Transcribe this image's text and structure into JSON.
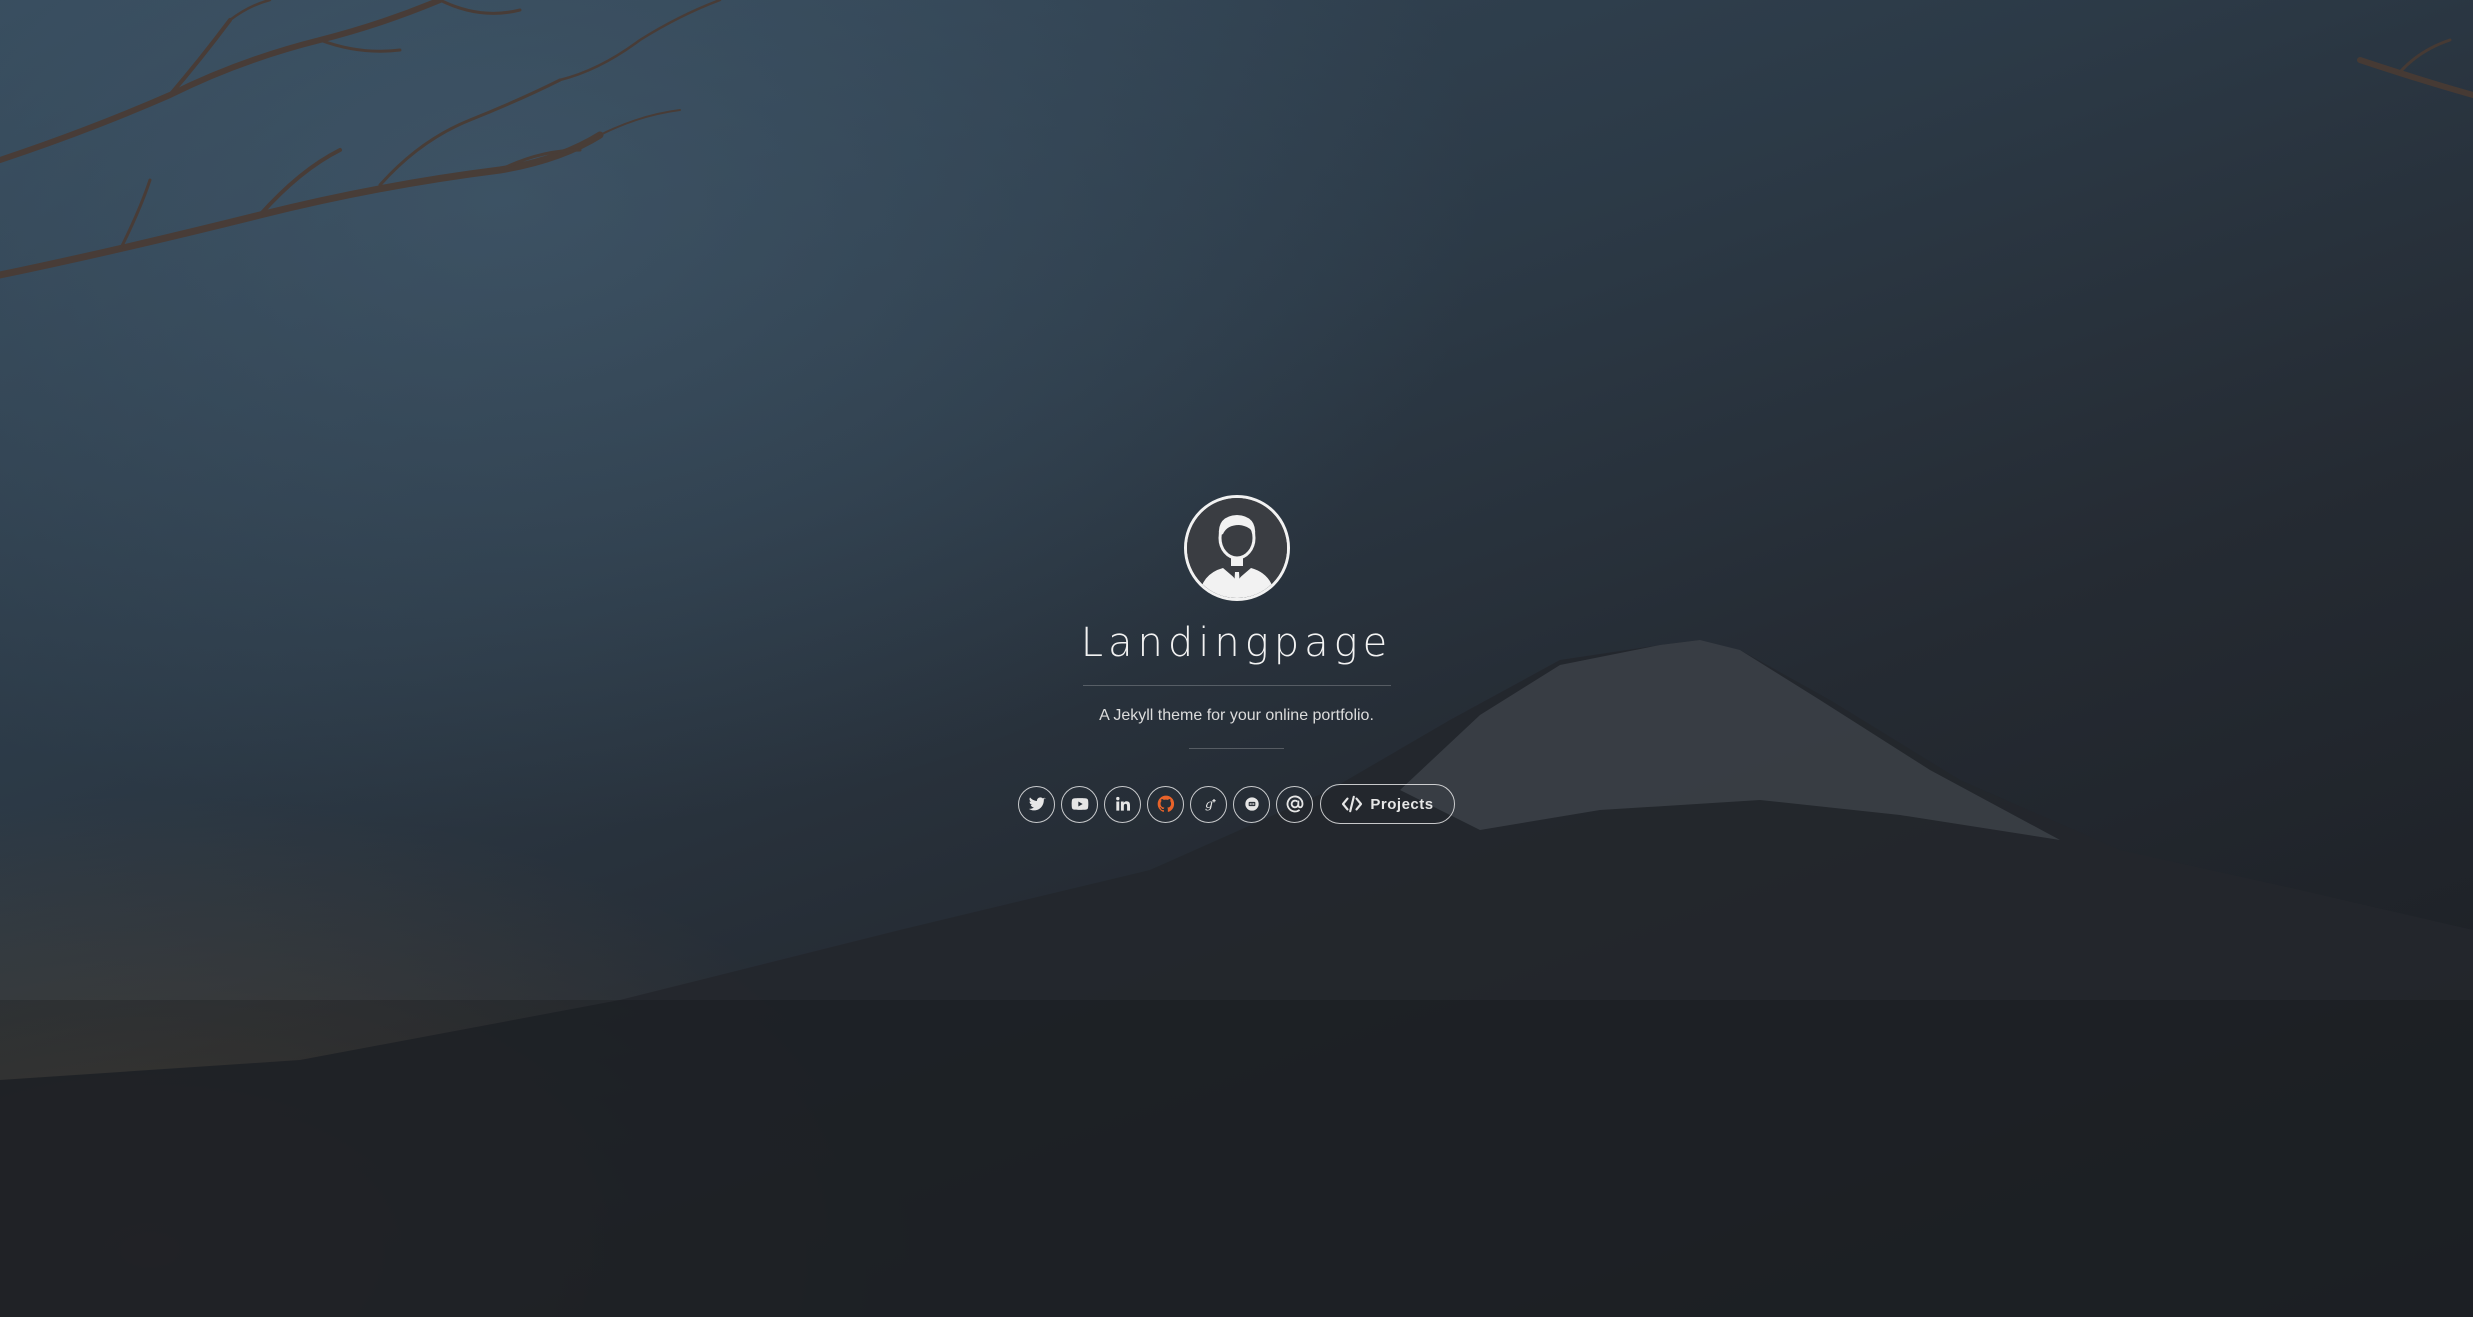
{
  "hero": {
    "title": "Landingpage",
    "tagline": "A Jekyll theme for your online portfolio."
  },
  "social": [
    {
      "name": "twitter-link",
      "icon": "twitter-icon"
    },
    {
      "name": "youtube-link",
      "icon": "youtube-icon"
    },
    {
      "name": "linkedin-link",
      "icon": "linkedin-icon"
    },
    {
      "name": "github-link",
      "icon": "github-icon",
      "color": "#e8632a"
    },
    {
      "name": "google-plus-link",
      "icon": "google-plus-icon"
    },
    {
      "name": "chat-link",
      "icon": "chat-bubble-icon"
    },
    {
      "name": "email-link",
      "icon": "at-sign-icon"
    }
  ],
  "projects_button": {
    "label": "Projects",
    "icon": "code-icon"
  },
  "colors": {
    "text": "#f2f2f2",
    "github_accent": "#e8632a",
    "sky_top": "#35495a",
    "ground": "#1a1c20"
  }
}
